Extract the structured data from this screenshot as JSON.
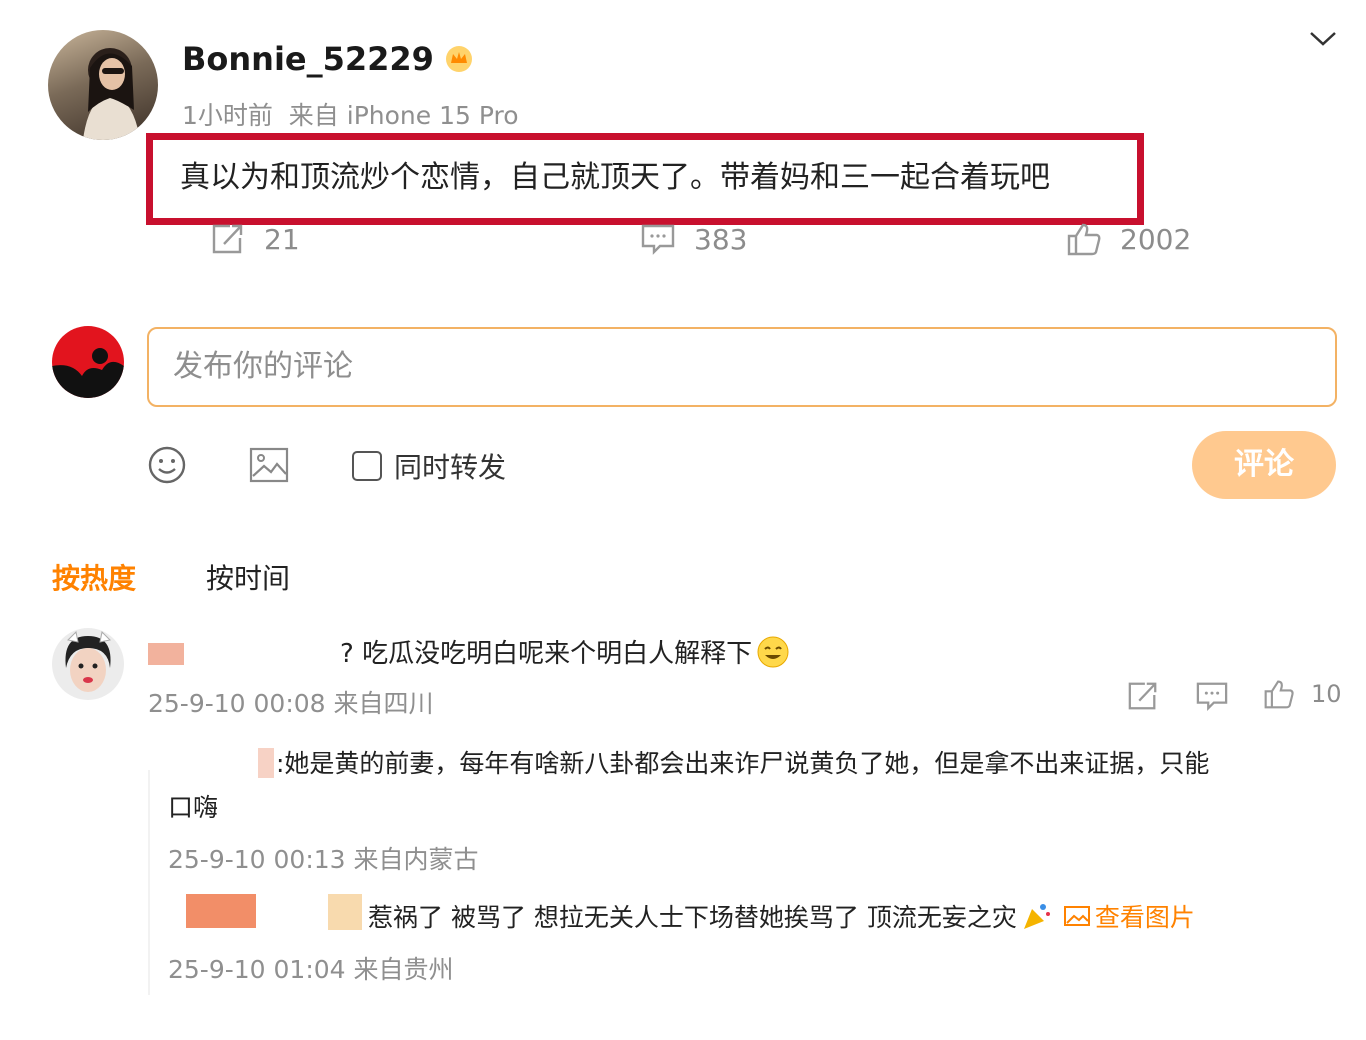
{
  "post": {
    "username": "Bonnie_52229",
    "meta": "1小时前  来自 iPhone 15 Pro",
    "content": "真以为和顶流炒个恋情，自己就顶天了。带着妈和三一起合着玩吧",
    "reposts": "21",
    "comments": "383",
    "likes": "2002"
  },
  "composer": {
    "placeholder": "发布你的评论",
    "repost_label": "同时转发",
    "submit_label": "评论"
  },
  "sort": {
    "hot_label": "按热度",
    "time_label": "按时间"
  },
  "comments": [
    {
      "text": "? 吃瓜没吃明白呢来个明白人解释下",
      "meta": "25-9-10 00:08 来自四川",
      "likes": "10",
      "replies": [
        {
          "text": ":她是黄的前妻，每年有啥新八卦都会出来诈尸说黄负了她，但是拿不出来证据，只能",
          "text_cont": "口嗨",
          "meta": "25-9-10 00:13 来自内蒙古"
        },
        {
          "text": "惹祸了 被骂了 想拉无关人士下场替她挨骂了 顶流无妄之灾",
          "view_image_label": "查看图片",
          "meta": "25-9-10 01:04 来自贵州"
        }
      ]
    }
  ],
  "colors": {
    "accent_orange": "#ff8200",
    "highlight_red": "#c8102e",
    "button_orange_light": "#ffc98f"
  }
}
